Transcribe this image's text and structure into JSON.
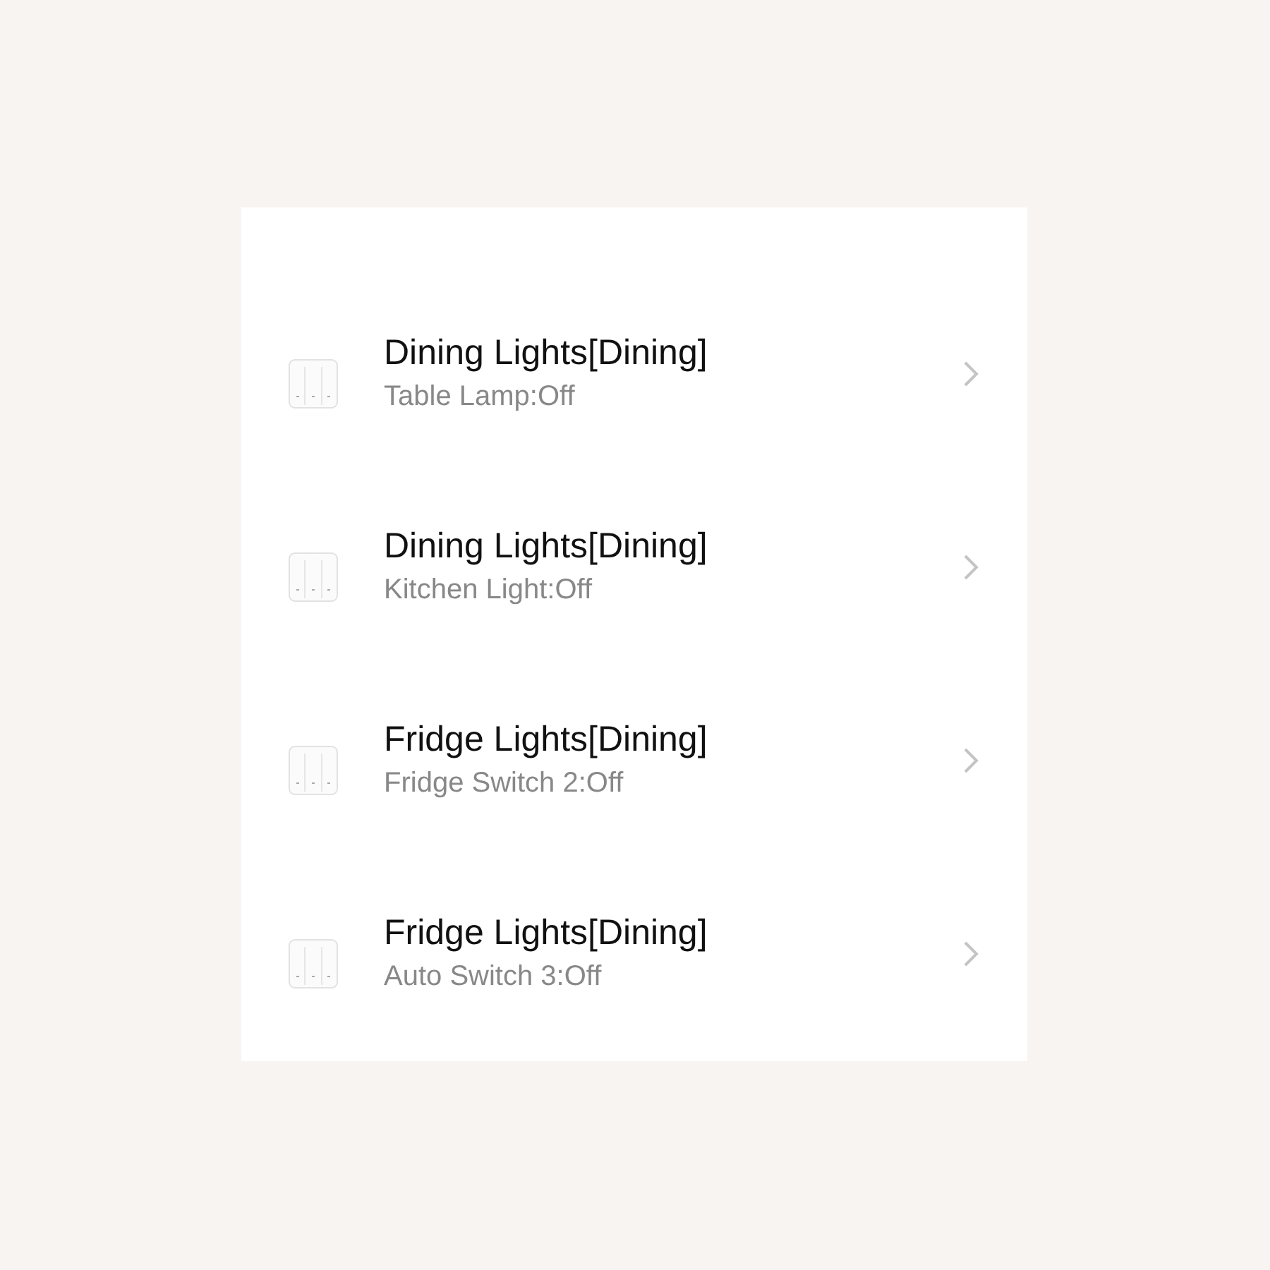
{
  "devices": [
    {
      "title": "Dining Lights[Dining]",
      "subtitle": "Table Lamp:Off"
    },
    {
      "title": "Dining Lights[Dining]",
      "subtitle": "Kitchen Light:Off"
    },
    {
      "title": "Fridge Lights[Dining]",
      "subtitle": "Fridge Switch 2:Off"
    },
    {
      "title": "Fridge Lights[Dining]",
      "subtitle": "Auto Switch 3:Off"
    }
  ]
}
